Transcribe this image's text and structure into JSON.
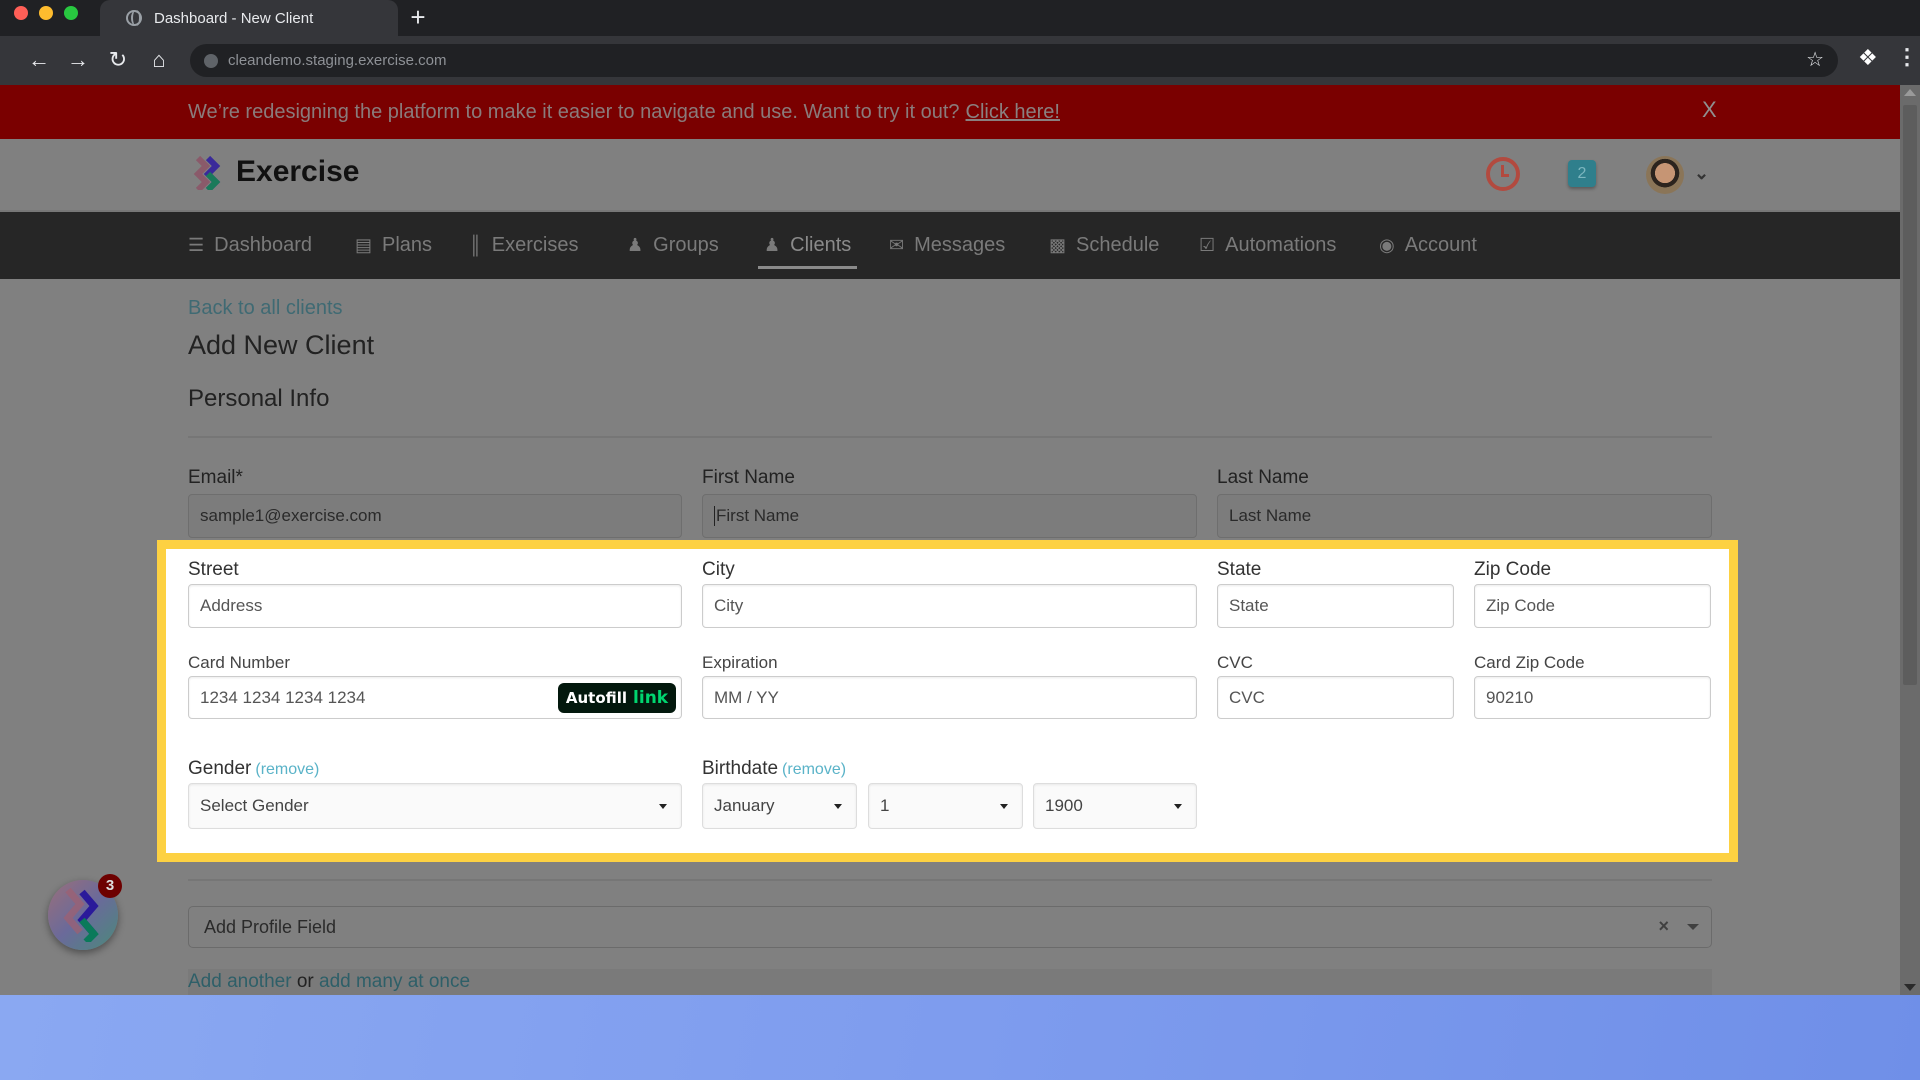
{
  "browser": {
    "tab_title": "Dashboard - New Client",
    "new_tab_label": "+",
    "url": "cleandemo.staging.exercise.com"
  },
  "banner": {
    "message": "We’re redesigning the platform to make it easier to navigate and use. Want to try it out?",
    "cta": "Click here!",
    "close_label": "X",
    "color": "#7a0000"
  },
  "header": {
    "brand": "Exercise",
    "notification_count": "2"
  },
  "nav": {
    "items": [
      {
        "label": "Dashboard",
        "icon": "list-icon"
      },
      {
        "label": "Plans",
        "icon": "clipboard-icon"
      },
      {
        "label": "Exercises",
        "icon": "dumbbell-icon"
      },
      {
        "label": "Groups",
        "icon": "users-icon"
      },
      {
        "label": "Clients",
        "icon": "user-icon",
        "active": true
      },
      {
        "label": "Messages",
        "icon": "envelope-icon"
      },
      {
        "label": "Schedule",
        "icon": "book-icon"
      },
      {
        "label": "Automations",
        "icon": "checkbox-icon"
      },
      {
        "label": "Account",
        "icon": "user-circle-icon"
      }
    ]
  },
  "page": {
    "back_link": "Back to all clients",
    "title": "Add New Client",
    "section": "Personal Info"
  },
  "form": {
    "email": {
      "label": "Email*",
      "value": "sample1@exercise.com"
    },
    "first_name": {
      "label": "First Name",
      "placeholder": "First Name"
    },
    "last_name": {
      "label": "Last Name",
      "placeholder": "Last Name"
    },
    "street": {
      "label": "Street",
      "placeholder": "Address"
    },
    "city": {
      "label": "City",
      "placeholder": "City"
    },
    "state": {
      "label": "State",
      "placeholder": "State"
    },
    "zip": {
      "label": "Zip Code",
      "placeholder": "Zip Code"
    },
    "card_number": {
      "label": "Card Number",
      "placeholder": "1234 1234 1234 1234",
      "autofill": "Autofill",
      "autofill_brand": "link"
    },
    "expiration": {
      "label": "Expiration",
      "placeholder": "MM / YY"
    },
    "cvc": {
      "label": "CVC",
      "placeholder": "CVC"
    },
    "card_zip": {
      "label": "Card Zip Code",
      "value": "90210"
    },
    "gender": {
      "label": "Gender",
      "remove": "(remove)",
      "selected": "Select Gender"
    },
    "birthdate": {
      "label": "Birthdate",
      "remove": "(remove)",
      "month": "January",
      "day": "1",
      "year": "1900"
    },
    "profile_field": {
      "placeholder": "Add Profile Field",
      "clear": "×"
    },
    "add_another": "Add another",
    "or": "or",
    "add_many": "add many at once"
  },
  "widget": {
    "badge_count": "3"
  },
  "highlight_color": "#fdd142"
}
